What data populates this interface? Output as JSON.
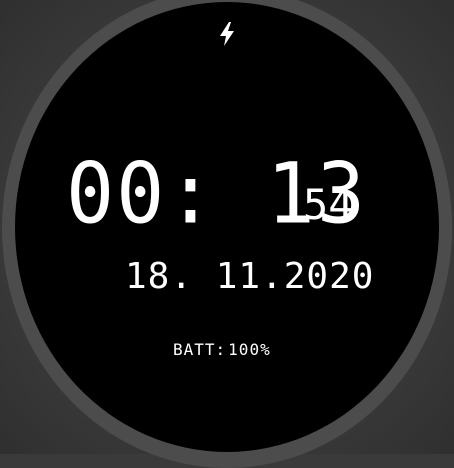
{
  "status": {
    "charging_icon": "lightning-bolt-icon"
  },
  "time": {
    "hours_minutes": "00: 13",
    "seconds": "54"
  },
  "date": {
    "text": "18. 11.2020"
  },
  "battery": {
    "label": "BATT:",
    "value": "100%"
  },
  "colors": {
    "background": "#000000",
    "bezel": "#4c4c4c",
    "text": "#ffffff"
  }
}
